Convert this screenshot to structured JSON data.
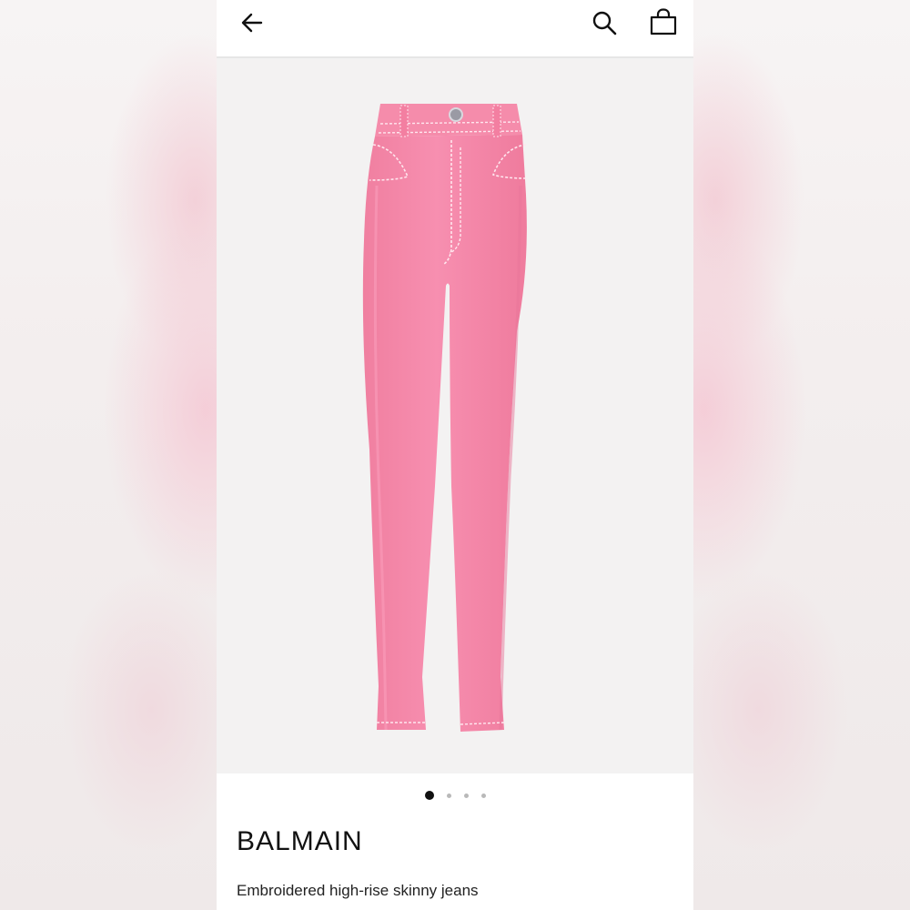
{
  "header": {
    "back_icon": "arrow-left-icon",
    "search_icon": "search-icon",
    "bag_icon": "shopping-bag-icon"
  },
  "gallery": {
    "image_subject": "pink high-rise skinny jeans",
    "total_images": 4,
    "active_index": 0
  },
  "product": {
    "brand": "BALMAIN",
    "name": "Embroidered high-rise skinny jeans"
  },
  "colors": {
    "jeans_pink": "#f48aaa",
    "stitching": "#ffe6ee"
  }
}
